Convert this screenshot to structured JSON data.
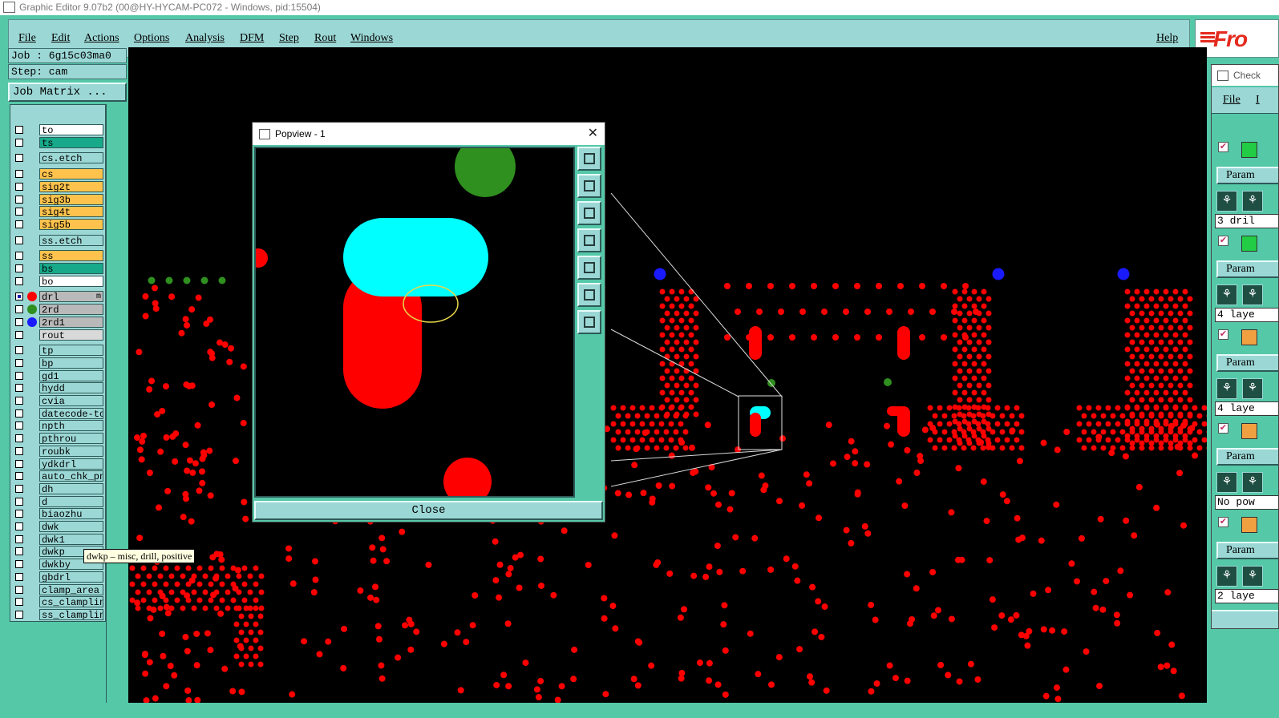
{
  "window": {
    "title": "Graphic Editor 9.07b2 (00@HY-HYCAM-PC072 - Windows, pid:15504)"
  },
  "menu": {
    "items": [
      "File",
      "Edit",
      "Actions",
      "Options",
      "Analysis",
      "DFM",
      "Step",
      "Rout",
      "Windows"
    ],
    "help": "Help"
  },
  "logo": {
    "text": "Fro",
    "icon": "frontline-logo"
  },
  "job": {
    "job_line": "Job : 6g15c03ma0",
    "step_line": "Step: cam",
    "matrix_button": "Job Matrix ..."
  },
  "layers": [
    {
      "name": "to",
      "bg": "#ffffff"
    },
    {
      "name": "ts",
      "bg": "#17a98a"
    },
    {
      "name": "cs.etch",
      "bg": "#9bd7d5"
    },
    {
      "name": "cs",
      "bg": "#ffc34d"
    },
    {
      "name": "sig2t",
      "bg": "#ffc34d"
    },
    {
      "name": "sig3b",
      "bg": "#ffc34d"
    },
    {
      "name": "sig4t",
      "bg": "#ffc34d"
    },
    {
      "name": "sig5b",
      "bg": "#ffc34d"
    },
    {
      "name": "ss.etch",
      "bg": "#9bd7d5"
    },
    {
      "name": "ss",
      "bg": "#ffc34d"
    },
    {
      "name": "bs",
      "bg": "#17a98a"
    },
    {
      "name": "bo",
      "bg": "#ffffff"
    },
    {
      "name": "drl",
      "bg": "#b9b9b9",
      "dot": "#ff0000",
      "checked": true,
      "mark": "m"
    },
    {
      "name": "2rd",
      "bg": "#b9b9b9",
      "dot": "#2f8f1f"
    },
    {
      "name": "2rd1",
      "bg": "#b9b9b9",
      "dot": "#1a1aff"
    },
    {
      "name": "rout",
      "bg": "#d9d9d9"
    },
    {
      "name": "tp",
      "bg": "#9bd7d5"
    },
    {
      "name": "bp",
      "bg": "#9bd7d5"
    },
    {
      "name": "gd1",
      "bg": "#9bd7d5"
    },
    {
      "name": "hydd",
      "bg": "#9bd7d5"
    },
    {
      "name": "cvia",
      "bg": "#9bd7d5"
    },
    {
      "name": "datecode-to",
      "bg": "#9bd7d5"
    },
    {
      "name": "npth",
      "bg": "#9bd7d5"
    },
    {
      "name": "pthrou",
      "bg": "#9bd7d5"
    },
    {
      "name": "roubk",
      "bg": "#9bd7d5"
    },
    {
      "name": "ydkdrl",
      "bg": "#9bd7d5"
    },
    {
      "name": "auto_chk_pn",
      "bg": "#9bd7d5"
    },
    {
      "name": "dh",
      "bg": "#9bd7d5"
    },
    {
      "name": "d",
      "bg": "#9bd7d5"
    },
    {
      "name": "biaozhu",
      "bg": "#9bd7d5"
    },
    {
      "name": "dwk",
      "bg": "#9bd7d5"
    },
    {
      "name": "dwk1",
      "bg": "#9bd7d5"
    },
    {
      "name": "dwkp",
      "bg": "#9bd7d5"
    },
    {
      "name": "dwkby",
      "bg": "#9bd7d5"
    },
    {
      "name": "gbdrl",
      "bg": "#9bd7d5"
    },
    {
      "name": "clamp_area",
      "bg": "#9bd7d5"
    },
    {
      "name": "cs_clamplin",
      "bg": "#9bd7d5"
    },
    {
      "name": "ss_clamplin",
      "bg": "#9bd7d5"
    }
  ],
  "tooltip": "dwkp – misc, drill, positive",
  "popview": {
    "title": "Popview - 1",
    "close_glyph": "✕",
    "close_button": "Close",
    "tools": [
      "zoom-fit-icon",
      "pan-up-icon",
      "pan-down-icon",
      "pan-left-icon",
      "pan-right-icon",
      "zoom-out-icon",
      "zoom-in-icon"
    ]
  },
  "check_window": {
    "title": "Check",
    "menu_file": "File",
    "menu_next": "I",
    "blocks": [
      {
        "param": "Param",
        "result": "3 dril",
        "status": "#22cc44"
      },
      {
        "param": "Param",
        "result": "4 laye",
        "status": "#22cc44"
      },
      {
        "param": "Param",
        "result": "4 laye",
        "status": "#f0a040"
      },
      {
        "param": "Param",
        "result": "No pow",
        "status": "#f0a040"
      },
      {
        "param": "Param",
        "result": "2 laye",
        "status": "#f0a040"
      }
    ],
    "check_glyph": "✔"
  },
  "colors": {
    "panel": "#9bd7d5",
    "frame": "#55c8a8",
    "pad_red": "#ff0000",
    "pad_green": "#2f8f1f",
    "pad_blue": "#1a1aff",
    "highlight_cyan": "#00ffff"
  }
}
